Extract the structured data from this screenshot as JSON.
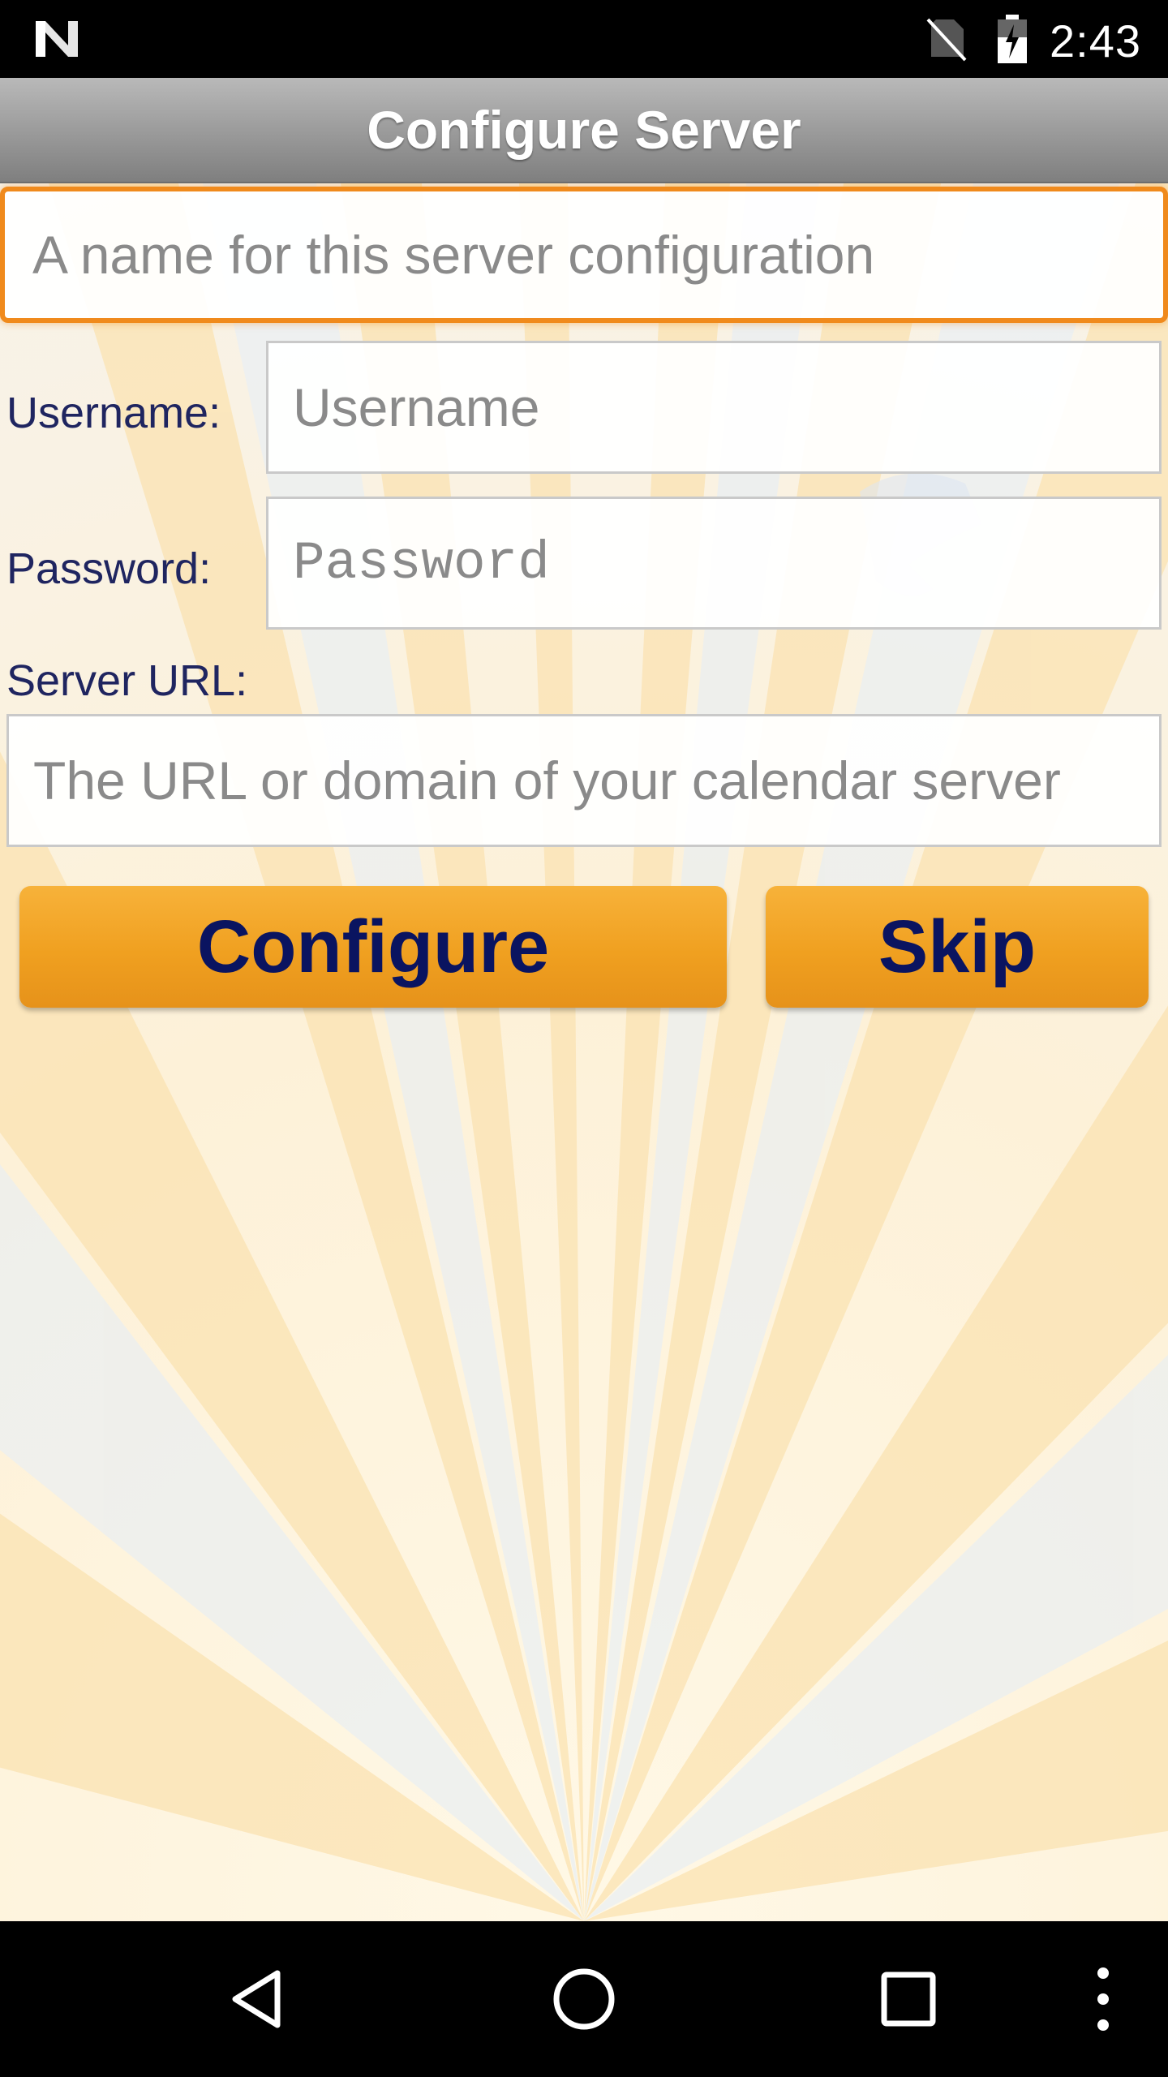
{
  "status_bar": {
    "time": "2:43",
    "icons": [
      "notification-n-icon",
      "no-sim-icon",
      "battery-charging-icon"
    ]
  },
  "header": {
    "title": "Configure Server"
  },
  "form": {
    "config_name": {
      "placeholder": "A name for this server configuration",
      "value": ""
    },
    "username": {
      "label": "Username:",
      "placeholder": "Username",
      "value": ""
    },
    "password": {
      "label": "Password:",
      "placeholder": "Password",
      "value": ""
    },
    "server_url": {
      "label": "Server URL:",
      "placeholder": "The URL or domain of your calendar server",
      "value": ""
    }
  },
  "buttons": {
    "configure_label": "Configure",
    "skip_label": "Skip"
  },
  "nav_bar": {
    "icons": [
      "back-icon",
      "home-icon",
      "recents-icon",
      "more-options-icon"
    ]
  },
  "colors": {
    "accent": "#f0a020",
    "focus_border": "#f08a1c",
    "label_text": "#1f2560",
    "button_text": "#0a1460"
  }
}
